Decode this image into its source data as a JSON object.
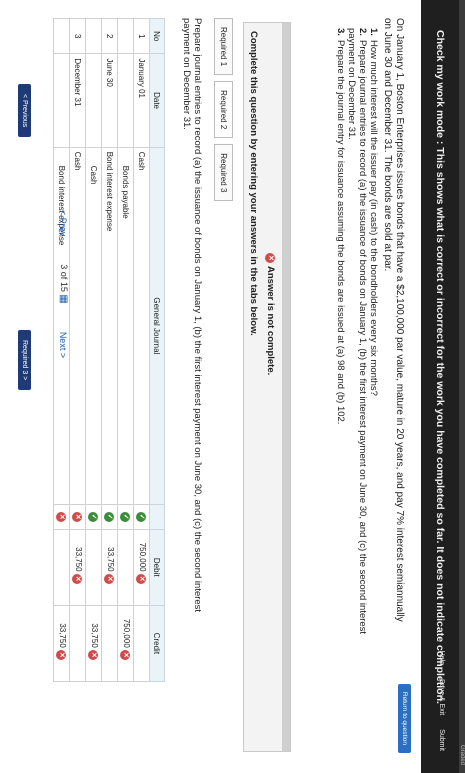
{
  "header": {
    "title": "Check my work mode : This shows what is correct or incorrect for the work you have completed so far. It does not indicate completion.",
    "graded_label": "Graded",
    "help_label": "Help",
    "save_exit_label": "Save & Exit",
    "submit_label": "Submit",
    "return_label": "Return to question"
  },
  "question": {
    "intro": "On January 1, Boston Enterprises issues bonds that have a $2,100,000 par value, mature in 20 years, and pay 7% interest semiannually on June 30 and December 31. The bonds are sold at par.",
    "items": [
      {
        "num": "1.",
        "text": "How much interest will the issuer pay (in cash) to the bondholders every six months?"
      },
      {
        "num": "2.",
        "text": "Prepare journal entries to record (a) the issuance of bonds on January 1, (b) the first interest payment on June 30, and (c) the second interest payment on December 31."
      },
      {
        "num": "3.",
        "text": "Prepare the journal entry for issuance assuming the bonds are issued at (a) 98 and (b) 102."
      }
    ]
  },
  "status": {
    "answer_label": "Answer is not complete.",
    "complete_label": "Complete this question by entering your answers in the tabs below."
  },
  "tabs": [
    {
      "label": "Required 1"
    },
    {
      "label": "Required 2"
    },
    {
      "label": "Required 3"
    }
  ],
  "instruction": "Prepare journal entries to record (a) the issuance of bonds on January 1, (b) the first interest payment on June 30, and (c) the second interest payment on December 31.",
  "table": {
    "headers": {
      "no": "No",
      "date": "Date",
      "general_journal": "General Journal",
      "debit": "Debit",
      "credit": "Credit"
    },
    "rows": [
      {
        "no": "1",
        "date": "January 01",
        "account": "Cash",
        "debit": "750,000",
        "credit": "",
        "account_ok": true,
        "debit_ok": false,
        "credit_ok": null
      },
      {
        "no": "",
        "date": "",
        "account": "Bonds payable",
        "debit": "",
        "credit": "750,000",
        "account_ok": true,
        "debit_ok": null,
        "credit_ok": false
      },
      {
        "no": "2",
        "date": "June 30",
        "account": "Bond interest expense",
        "debit": "33,750",
        "credit": "",
        "account_ok": true,
        "debit_ok": false,
        "credit_ok": null
      },
      {
        "no": "",
        "date": "",
        "account": "Cash",
        "debit": "",
        "credit": "33,750",
        "account_ok": true,
        "debit_ok": null,
        "credit_ok": false
      },
      {
        "no": "3",
        "date": "December 31",
        "account": "Cash",
        "debit": "33,750",
        "credit": "",
        "account_ok": false,
        "debit_ok": false,
        "credit_ok": null
      },
      {
        "no": "",
        "date": "",
        "account": "Bond interest expense",
        "debit": "",
        "credit": "33,750",
        "account_ok": false,
        "debit_ok": null,
        "credit_ok": false
      }
    ]
  },
  "buttons": {
    "previous": "< Previous",
    "next_required": "Required 3 >"
  },
  "footer": {
    "prev": "< Prev",
    "current": "3",
    "of_label": "of",
    "total": "15",
    "next": "Next >"
  },
  "colors": {
    "topbar": "#1f1f1f",
    "accent": "#2b6fc3",
    "correct": "#3b8c3b",
    "incorrect": "#d14b4b",
    "nav_button": "#1f3b77"
  }
}
